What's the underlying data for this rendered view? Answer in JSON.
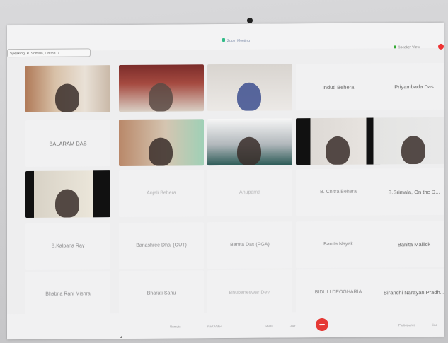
{
  "header": {
    "speaking": "Speaking: B. Srimala, On the D...",
    "meeting_title": "Zoom Meeting",
    "view_label": "Speaker View"
  },
  "tiles": [
    {
      "type": "video",
      "variant": "vid1",
      "label": ""
    },
    {
      "type": "video",
      "variant": "vid2",
      "label": ""
    },
    {
      "type": "video",
      "variant": "vid3",
      "label": ""
    },
    {
      "type": "name",
      "label": "Induti Behera",
      "style": "dark"
    },
    {
      "type": "name",
      "label": "Priyambada Das",
      "style": "dark"
    },
    {
      "type": "name",
      "label": "BALARAM DAS",
      "style": "dark"
    },
    {
      "type": "video",
      "variant": "vid4",
      "label": ""
    },
    {
      "type": "video",
      "variant": "vid5",
      "label": ""
    },
    {
      "type": "video",
      "variant": "vid6",
      "label": ""
    },
    {
      "type": "video",
      "variant": "vid7",
      "label": ""
    },
    {
      "type": "video",
      "variant": "vid8",
      "label": ""
    },
    {
      "type": "name",
      "label": "Anjali Behera",
      "style": "faint"
    },
    {
      "type": "name",
      "label": "Anupama",
      "style": "faint"
    },
    {
      "type": "name",
      "label": "B. Chitra Behera",
      "style": "normal"
    },
    {
      "type": "name",
      "label": "B.Srimala, On the D...",
      "style": "dark"
    },
    {
      "type": "name",
      "label": "B.Kalpana Ray",
      "style": "normal"
    },
    {
      "type": "name",
      "label": "Banashree Dhal (OUT)",
      "style": "normal"
    },
    {
      "type": "name",
      "label": "Banita Das (PGA)",
      "style": "normal"
    },
    {
      "type": "name",
      "label": "Banita Nayak",
      "style": "normal"
    },
    {
      "type": "name",
      "label": "Banita Mallick",
      "style": "dark"
    },
    {
      "type": "name",
      "label": "Bhabna Rani Mishra",
      "style": "normal"
    },
    {
      "type": "name",
      "label": "Bharati Sahu",
      "style": "normal"
    },
    {
      "type": "name",
      "label": "Bhubaneswar Devi",
      "style": "faint"
    },
    {
      "type": "name",
      "label": "BIDULI DEOGHARIA",
      "style": "normal"
    },
    {
      "type": "name",
      "label": "Biranchi Narayan Pradh...",
      "style": "dark"
    }
  ],
  "toolbar": {
    "items": [
      "Unmute",
      "Start Video",
      "Share",
      "Chat",
      "Participants",
      "End"
    ]
  }
}
